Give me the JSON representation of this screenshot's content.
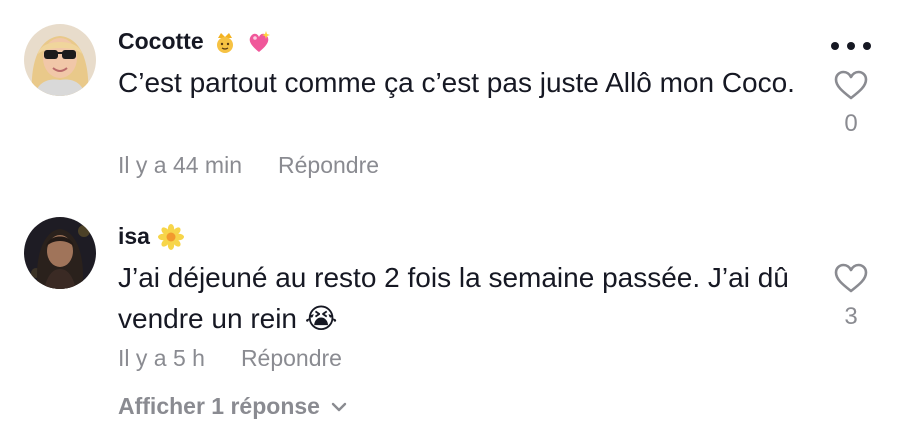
{
  "comments": [
    {
      "username": "Cocotte",
      "text": "C’est partout comme ça c’est pas juste Allô mon Coco.",
      "time": "Il y a 44 min",
      "reply_label": "Répondre",
      "likes": "0"
    },
    {
      "username": "isa",
      "text": "J’ai déjeuné au resto 2 fois la semaine passée. J’ai dû vendre un rein 😭",
      "time": "Il y a 5 h",
      "reply_label": "Répondre",
      "likes": "3",
      "view_replies_label": "Afficher 1 réponse"
    }
  ],
  "colors": {
    "text": "#161823",
    "muted": "#8a8b91"
  }
}
